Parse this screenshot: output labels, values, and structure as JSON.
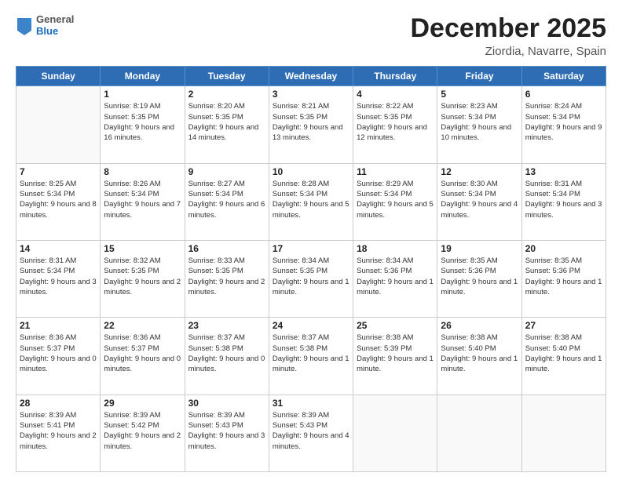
{
  "header": {
    "logo": {
      "general": "General",
      "blue": "Blue"
    },
    "title": "December 2025",
    "location": "Ziordia, Navarre, Spain"
  },
  "calendar": {
    "weekdays": [
      "Sunday",
      "Monday",
      "Tuesday",
      "Wednesday",
      "Thursday",
      "Friday",
      "Saturday"
    ],
    "weeks": [
      [
        {
          "day": "",
          "empty": true
        },
        {
          "day": "1",
          "sunrise": "8:19 AM",
          "sunset": "5:35 PM",
          "daylight": "9 hours and 16 minutes."
        },
        {
          "day": "2",
          "sunrise": "8:20 AM",
          "sunset": "5:35 PM",
          "daylight": "9 hours and 14 minutes."
        },
        {
          "day": "3",
          "sunrise": "8:21 AM",
          "sunset": "5:35 PM",
          "daylight": "9 hours and 13 minutes."
        },
        {
          "day": "4",
          "sunrise": "8:22 AM",
          "sunset": "5:35 PM",
          "daylight": "9 hours and 12 minutes."
        },
        {
          "day": "5",
          "sunrise": "8:23 AM",
          "sunset": "5:34 PM",
          "daylight": "9 hours and 10 minutes."
        },
        {
          "day": "6",
          "sunrise": "8:24 AM",
          "sunset": "5:34 PM",
          "daylight": "9 hours and 9 minutes."
        }
      ],
      [
        {
          "day": "7",
          "sunrise": "8:25 AM",
          "sunset": "5:34 PM",
          "daylight": "9 hours and 8 minutes."
        },
        {
          "day": "8",
          "sunrise": "8:26 AM",
          "sunset": "5:34 PM",
          "daylight": "9 hours and 7 minutes."
        },
        {
          "day": "9",
          "sunrise": "8:27 AM",
          "sunset": "5:34 PM",
          "daylight": "9 hours and 6 minutes."
        },
        {
          "day": "10",
          "sunrise": "8:28 AM",
          "sunset": "5:34 PM",
          "daylight": "9 hours and 5 minutes."
        },
        {
          "day": "11",
          "sunrise": "8:29 AM",
          "sunset": "5:34 PM",
          "daylight": "9 hours and 5 minutes."
        },
        {
          "day": "12",
          "sunrise": "8:30 AM",
          "sunset": "5:34 PM",
          "daylight": "9 hours and 4 minutes."
        },
        {
          "day": "13",
          "sunrise": "8:31 AM",
          "sunset": "5:34 PM",
          "daylight": "9 hours and 3 minutes."
        }
      ],
      [
        {
          "day": "14",
          "sunrise": "8:31 AM",
          "sunset": "5:34 PM",
          "daylight": "9 hours and 3 minutes."
        },
        {
          "day": "15",
          "sunrise": "8:32 AM",
          "sunset": "5:35 PM",
          "daylight": "9 hours and 2 minutes."
        },
        {
          "day": "16",
          "sunrise": "8:33 AM",
          "sunset": "5:35 PM",
          "daylight": "9 hours and 2 minutes."
        },
        {
          "day": "17",
          "sunrise": "8:34 AM",
          "sunset": "5:35 PM",
          "daylight": "9 hours and 1 minute."
        },
        {
          "day": "18",
          "sunrise": "8:34 AM",
          "sunset": "5:36 PM",
          "daylight": "9 hours and 1 minute."
        },
        {
          "day": "19",
          "sunrise": "8:35 AM",
          "sunset": "5:36 PM",
          "daylight": "9 hours and 1 minute."
        },
        {
          "day": "20",
          "sunrise": "8:35 AM",
          "sunset": "5:36 PM",
          "daylight": "9 hours and 1 minute."
        }
      ],
      [
        {
          "day": "21",
          "sunrise": "8:36 AM",
          "sunset": "5:37 PM",
          "daylight": "9 hours and 0 minutes."
        },
        {
          "day": "22",
          "sunrise": "8:36 AM",
          "sunset": "5:37 PM",
          "daylight": "9 hours and 0 minutes."
        },
        {
          "day": "23",
          "sunrise": "8:37 AM",
          "sunset": "5:38 PM",
          "daylight": "9 hours and 0 minutes."
        },
        {
          "day": "24",
          "sunrise": "8:37 AM",
          "sunset": "5:38 PM",
          "daylight": "9 hours and 1 minute."
        },
        {
          "day": "25",
          "sunrise": "8:38 AM",
          "sunset": "5:39 PM",
          "daylight": "9 hours and 1 minute."
        },
        {
          "day": "26",
          "sunrise": "8:38 AM",
          "sunset": "5:40 PM",
          "daylight": "9 hours and 1 minute."
        },
        {
          "day": "27",
          "sunrise": "8:38 AM",
          "sunset": "5:40 PM",
          "daylight": "9 hours and 1 minute."
        }
      ],
      [
        {
          "day": "28",
          "sunrise": "8:39 AM",
          "sunset": "5:41 PM",
          "daylight": "9 hours and 2 minutes."
        },
        {
          "day": "29",
          "sunrise": "8:39 AM",
          "sunset": "5:42 PM",
          "daylight": "9 hours and 2 minutes."
        },
        {
          "day": "30",
          "sunrise": "8:39 AM",
          "sunset": "5:43 PM",
          "daylight": "9 hours and 3 minutes."
        },
        {
          "day": "31",
          "sunrise": "8:39 AM",
          "sunset": "5:43 PM",
          "daylight": "9 hours and 4 minutes."
        },
        {
          "day": "",
          "empty": true
        },
        {
          "day": "",
          "empty": true
        },
        {
          "day": "",
          "empty": true
        }
      ]
    ]
  }
}
